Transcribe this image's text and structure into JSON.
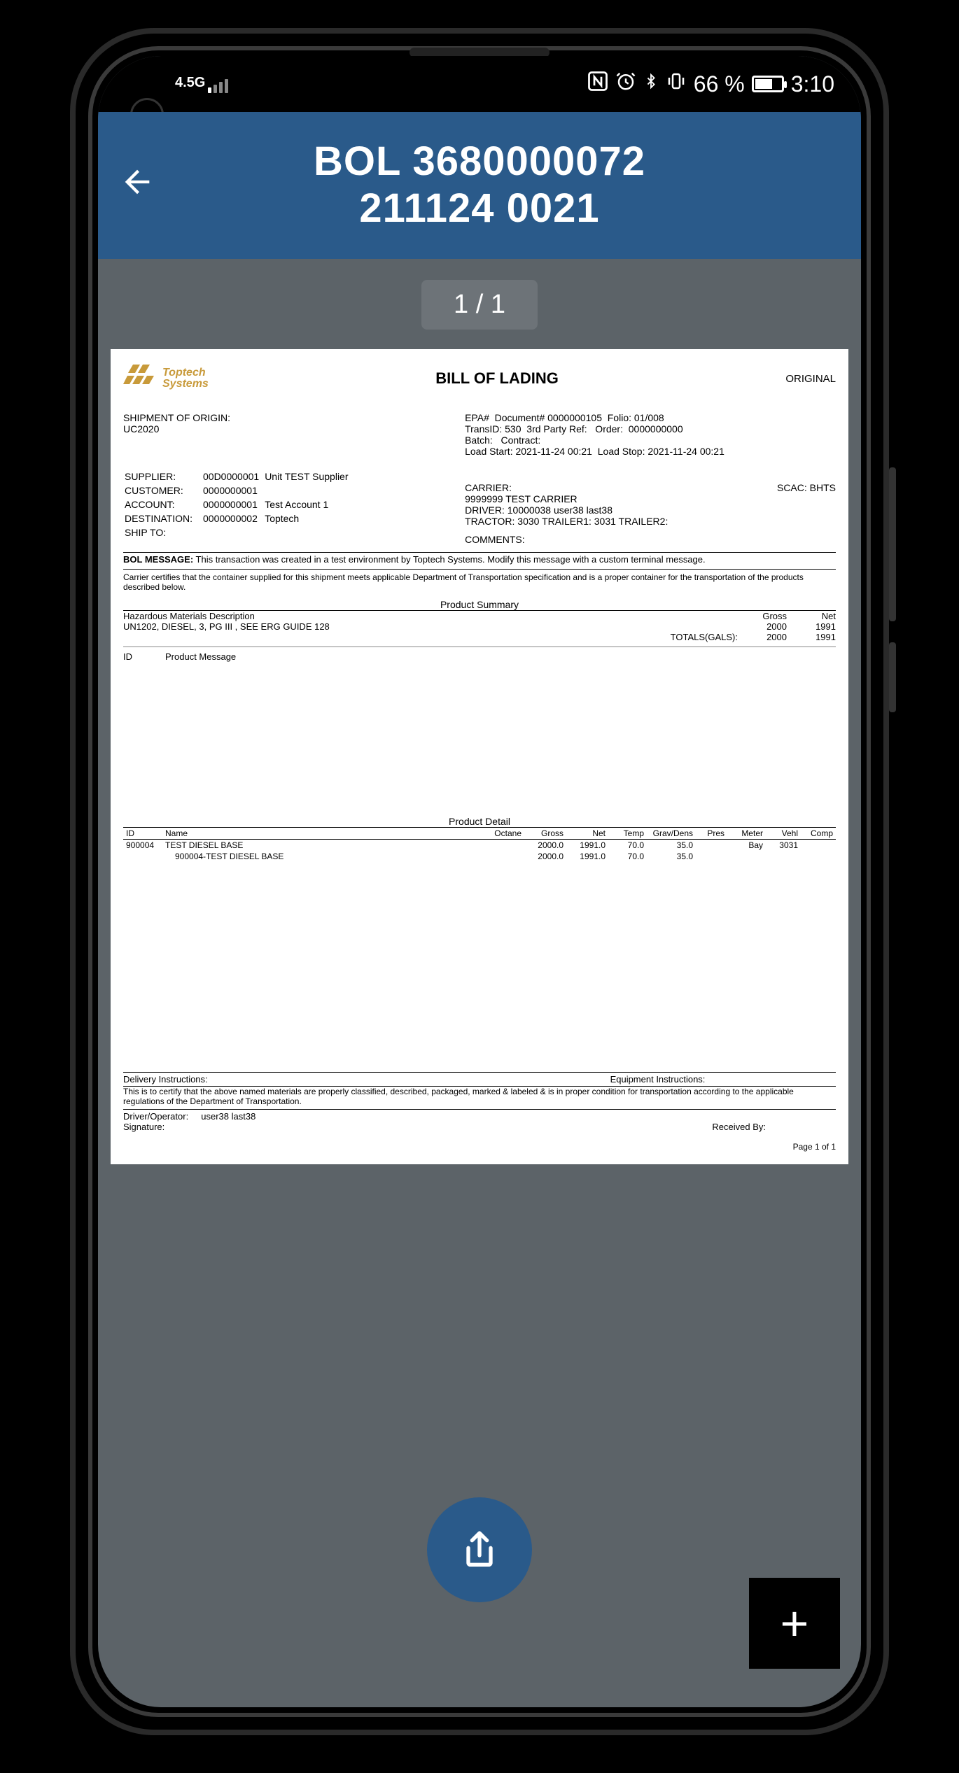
{
  "status": {
    "network_label": "4.5G",
    "battery_percent": "66 %",
    "time": "3:10"
  },
  "header": {
    "title_line1": "BOL 3680000072",
    "title_line2": "211124 0021"
  },
  "pager": {
    "label": "1 / 1"
  },
  "doc": {
    "logo_top": "Toptech",
    "logo_bottom": "Systems",
    "title": "BILL OF LADING",
    "original": "ORIGINAL",
    "shipment_origin_label": "SHIPMENT OF ORIGIN:",
    "shipment_origin_value": "UC2020",
    "right_info": {
      "epa": "EPA#  Document# 0000000105  Folio: 01/008",
      "trans": "TransID: 530  3rd Party Ref:   Order:  0000000000",
      "batch": "Batch:   Contract:",
      "load": "Load Start: 2021-11-24 00:21  Load Stop: 2021-11-24 00:21"
    },
    "parties": {
      "supplier": {
        "code": "00D0000001",
        "name": "Unit TEST Supplier"
      },
      "customer": {
        "code": "0000000001",
        "name": ""
      },
      "account": {
        "code": "0000000001",
        "name": "Test Account 1"
      },
      "destination": {
        "code": "0000000002",
        "name": "Toptech"
      },
      "ship_to": ""
    },
    "labels": {
      "supplier": "SUPPLIER:",
      "customer": "CUSTOMER:",
      "account": "ACCOUNT:",
      "destination": "DESTINATION:",
      "ship_to": "SHIP TO:"
    },
    "carrier": {
      "label": "CARRIER:",
      "scac_label": "SCAC: BHTS",
      "line2": "9999999  TEST CARRIER",
      "driver": "DRIVER: 10000038  user38  last38",
      "tractor": "TRACTOR: 3030 TRAILER1: 3031 TRAILER2:",
      "comments": "COMMENTS:"
    },
    "bol_msg_label": "BOL MESSAGE:",
    "bol_msg_text": "  This transaction was created in   a test environment by Toptech Systems.   Modify this message with   a custom terminal message.",
    "cert1": "Carrier certifies that the container supplied for this shipment meets applicable Department of Transportation specification and is a proper container for the transportation of the products described below.",
    "summary": {
      "title": "Product Summary",
      "desc_label": "Hazardous Materials Description",
      "gross_label": "Gross",
      "net_label": "Net",
      "desc": "UN1202, DIESEL, 3, PG III ,     SEE ERG GUIDE 128",
      "gross": "2000",
      "net": "1991",
      "totals_label": "TOTALS(GALS):",
      "totals_gross": "2000",
      "totals_net": "1991"
    },
    "pm": {
      "id_label": "ID",
      "msg_label": "Product Message"
    },
    "detail": {
      "title": "Product Detail",
      "head": {
        "id": "ID",
        "name": "Name",
        "octane": "Octane",
        "gross": "Gross",
        "net": "Net",
        "temp": "Temp",
        "grav": "Grav/Dens",
        "pres": "Pres",
        "meter": "Meter",
        "vehl": "Vehl",
        "comp": "Comp"
      },
      "rows": [
        {
          "id": "900004",
          "name": "TEST DIESEL BASE",
          "octane": "",
          "gross": "2000.0",
          "net": "1991.0",
          "temp": "70.0",
          "grav": "35.0",
          "pres": "",
          "meter": "Bay",
          "vehl": "3031",
          "comp": ""
        },
        {
          "id": "",
          "name": "900004-TEST DIESEL BASE",
          "octane": "",
          "gross": "2000.0",
          "net": "1991.0",
          "temp": "70.0",
          "grav": "35.0",
          "pres": "",
          "meter": "",
          "vehl": "",
          "comp": ""
        }
      ]
    },
    "delivery_instr": "Delivery Instructions:",
    "equip_instr": "Equipment Instructions:",
    "cert2": "This is to certify that the above named materials are properly classified, described, packaged, marked & labeled & is in proper condition for transportation according to the applicable regulations of the Department of Transportation.",
    "driver_op_label": "Driver/Operator:",
    "driver_op_value": "user38  last38",
    "signature_label": "Signature:",
    "received_by": "Received By:",
    "page_label": "Page 1 of 1"
  }
}
